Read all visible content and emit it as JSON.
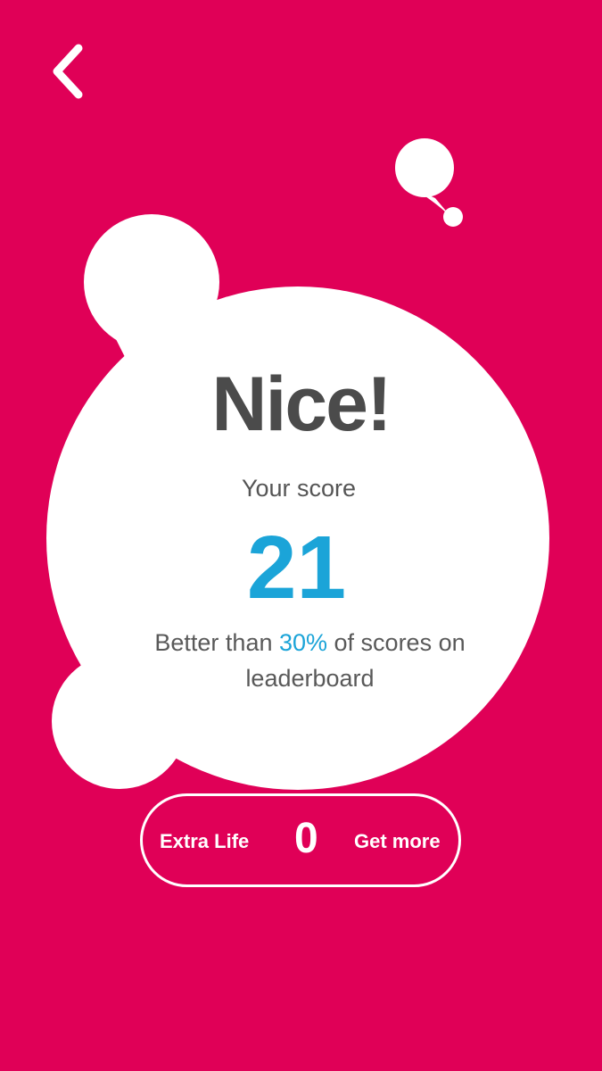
{
  "result": {
    "title": "Nice!",
    "score_label": "Your score",
    "score": "21",
    "rank_prefix": "Better than ",
    "rank_percent": "30%",
    "rank_suffix": " of scores on leaderboard"
  },
  "extra_life": {
    "label": "Extra Life",
    "count": "0",
    "action_label": "Get more"
  },
  "icons": {
    "back": "chevron-left-icon"
  },
  "colors": {
    "background": "#e00057",
    "card": "#ffffff",
    "title": "#4b4b4b",
    "accent": "#1ba4d8",
    "text": "#595959"
  }
}
